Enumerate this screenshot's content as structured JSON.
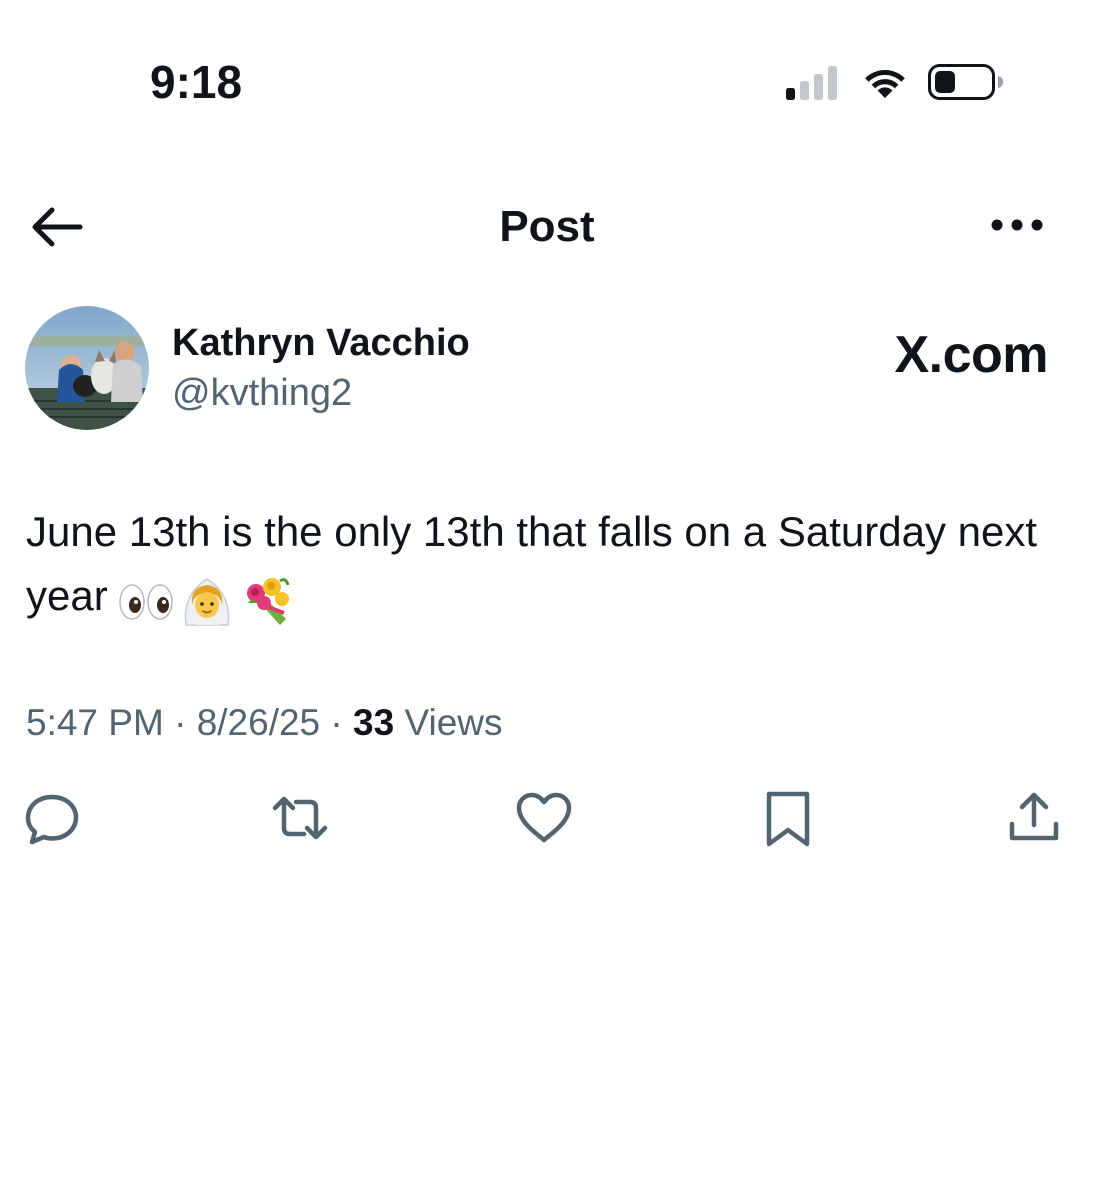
{
  "status_bar": {
    "time": "9:18",
    "signal_icon": "cellular-signal-icon",
    "signal_bars_active": 1,
    "signal_bars_total": 4,
    "wifi_icon": "wifi-icon",
    "battery_icon": "battery-icon",
    "battery_level": 0.3
  },
  "nav": {
    "title": "Post",
    "back_icon": "arrow-left-icon",
    "more_icon": "more-horizontal-icon"
  },
  "author": {
    "name": "Kathryn Vacchio",
    "handle": "@kvthing2",
    "avatar_icon": "avatar"
  },
  "source_watermark": "X.com",
  "post": {
    "text": "June 13th is the only 13th that falls on a Saturday next year",
    "emojis": [
      "eyes-emoji",
      "bride-emoji",
      "bouquet-emoji"
    ]
  },
  "meta": {
    "time": "5:47 PM",
    "separator": "·",
    "date": "8/26/25",
    "views_count": "33",
    "views_label": "Views"
  },
  "actions": [
    {
      "name": "reply",
      "icon": "reply-icon"
    },
    {
      "name": "repost",
      "icon": "repost-icon"
    },
    {
      "name": "like",
      "icon": "heart-icon"
    },
    {
      "name": "bookmark",
      "icon": "bookmark-icon"
    },
    {
      "name": "share",
      "icon": "share-icon"
    }
  ],
  "colors": {
    "text_primary": "#0f1419",
    "text_secondary": "#536471",
    "icon_gray": "#536471",
    "background": "#ffffff"
  }
}
